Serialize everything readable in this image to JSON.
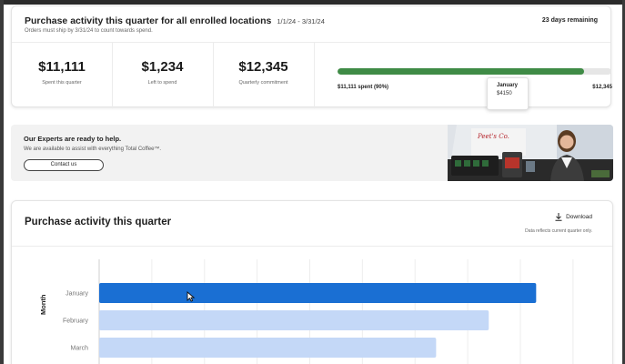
{
  "summary": {
    "title": "Purchase activity this quarter for all enrolled locations",
    "dates": "1/1/24 - 3/31/24",
    "subtitle": "Orders must ship by 3/31/24 to count towards spend.",
    "remaining": "23 days remaining",
    "stats": [
      {
        "value": "$11,111",
        "label": "Spent this quarter"
      },
      {
        "value": "$1,234",
        "label": "Left to spend"
      },
      {
        "value": "$12,345",
        "label": "Quarterly commitment"
      }
    ],
    "progress": {
      "fraction": 0.9,
      "left_label": "$11,111 spent (90%)",
      "right_label": "$12,345",
      "color": "#3f8b46"
    }
  },
  "experts": {
    "title": "Our Experts are ready to help.",
    "subtitle": "We are available to assist with everything Total Coffee™.",
    "button": "Contact us",
    "photo_sign": "Peet's Co."
  },
  "activity": {
    "title": "Purchase activity this quarter",
    "download": "Download",
    "note": "Data reflects current quarter only."
  },
  "chart_data": {
    "type": "bar",
    "orientation": "horizontal",
    "ylabel": "Month",
    "categories": [
      "January",
      "February",
      "March"
    ],
    "values": [
      4150,
      3700,
      3200
    ],
    "highlight_index": 0,
    "colors": {
      "highlight": "#1a6fd3",
      "normal": "#c4d8f7"
    },
    "tooltip": {
      "category": "January",
      "value": "$4150"
    }
  }
}
